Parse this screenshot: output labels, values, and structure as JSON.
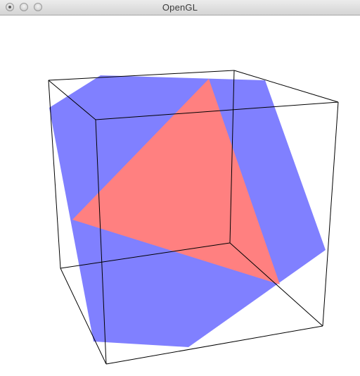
{
  "window": {
    "title": "OpenGL"
  },
  "scene": {
    "background_color": "#ffffff",
    "hexagon_color": "#8080ff",
    "triangle_color": "#ff8080",
    "edge_color": "#000000"
  }
}
